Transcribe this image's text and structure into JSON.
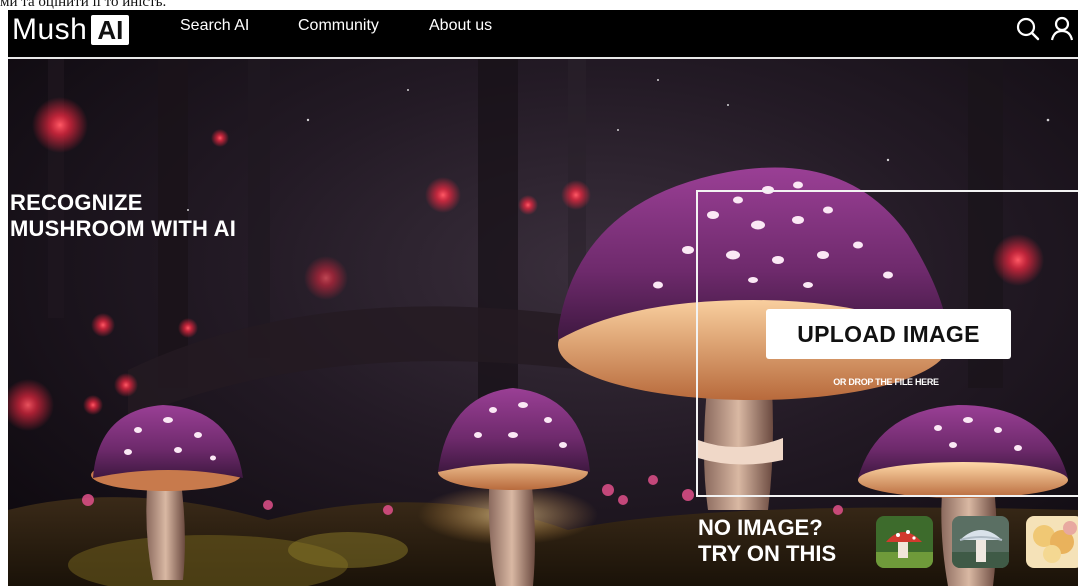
{
  "caption_fragment": "ми та оцінити її то иність.",
  "logo": {
    "text_mush": "Mush",
    "text_ai": "AI"
  },
  "nav": {
    "links": [
      "Search AI",
      "Community",
      "About us"
    ]
  },
  "icons": {
    "search": "search-icon",
    "user": "user-icon"
  },
  "hero": {
    "line1": "RECOGNIZE",
    "line2": "MUSHROOM WITH AI"
  },
  "upload": {
    "button_label": "UPLOAD IMAGE",
    "drop_text": "OR DROP THE FILE HERE"
  },
  "samples": {
    "line1": "NO IMAGE?",
    "line2": "TRY ON THIS",
    "thumbnails": [
      "sample-mushroom-1",
      "sample-mushroom-2",
      "sample-mushroom-3"
    ]
  },
  "colors": {
    "nav_bg": "#000000",
    "forest_dark": "#120c14",
    "cap_purple": "#7a2a78",
    "glow_red": "#ff3a4a",
    "text": "#ffffff"
  }
}
